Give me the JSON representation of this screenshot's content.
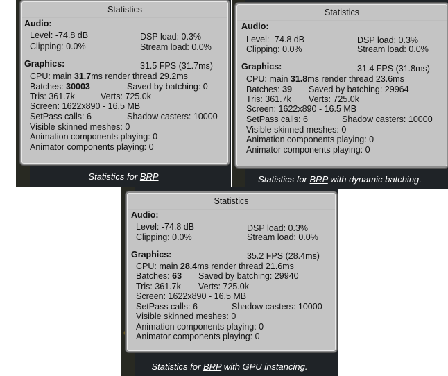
{
  "panels": [
    {
      "title": "Statistics",
      "audio_header": "Audio:",
      "audio_level": "Level: -74.8 dB",
      "audio_clipping": "Clipping: 0.0%",
      "audio_dsp": "DSP load: 0.3%",
      "audio_stream": "Stream load: 0.0%",
      "graphics_header": "Graphics:",
      "fps": "31.5 FPS (31.7ms)",
      "cpu_prefix": "CPU: main ",
      "cpu_main": "31.7",
      "cpu_suffix": "ms  render thread 29.2ms",
      "batches_prefix": "Batches: ",
      "batches": "30003",
      "saved_by_batching": "Saved by batching: 0",
      "tris": "Tris: 361.7k",
      "verts": "Verts: 725.0k",
      "screen": "Screen: 1622x890 - 16.5 MB",
      "setpass": "SetPass calls: 6",
      "shadow_casters": "Shadow casters: 10000",
      "visible_skinned": "Visible skinned meshes: 0",
      "animation_components": "Animation components playing: 0",
      "animator_components": "Animator components playing: 0",
      "caption_pre": "Statistics for ",
      "caption_link": "BRP",
      "caption_post": ""
    },
    {
      "title": "Statistics",
      "audio_header": "Audio:",
      "audio_level": "Level: -74.8 dB",
      "audio_clipping": "Clipping: 0.0%",
      "audio_dsp": "DSP load: 0.3%",
      "audio_stream": "Stream load: 0.0%",
      "graphics_header": "Graphics:",
      "fps": "31.4 FPS (31.8ms)",
      "cpu_prefix": "CPU: main ",
      "cpu_main": "31.8",
      "cpu_suffix": "ms  render thread 23.6ms",
      "batches_prefix": "Batches: ",
      "batches": "39",
      "saved_by_batching": "Saved by batching: 29964",
      "tris": "Tris: 361.7k",
      "verts": "Verts: 725.0k",
      "screen": "Screen: 1622x890 - 16.5 MB",
      "setpass": "SetPass calls: 6",
      "shadow_casters": "Shadow casters: 10000",
      "visible_skinned": "Visible skinned meshes: 0",
      "animation_components": "Animation components playing: 0",
      "animator_components": "Animator components playing: 0",
      "caption_pre": "Statistics for ",
      "caption_link": "BRP",
      "caption_post": " with dynamic batching."
    },
    {
      "title": "Statistics",
      "audio_header": "Audio:",
      "audio_level": "Level: -74.8 dB",
      "audio_clipping": "Clipping: 0.0%",
      "audio_dsp": "DSP load: 0.3%",
      "audio_stream": "Stream load: 0.0%",
      "graphics_header": "Graphics:",
      "fps": "35.2 FPS (28.4ms)",
      "cpu_prefix": "CPU: main ",
      "cpu_main": "28.4",
      "cpu_suffix": "ms  render thread 21.6ms",
      "batches_prefix": "Batches: ",
      "batches": "63",
      "saved_by_batching": "Saved by batching: 29940",
      "tris": "Tris: 361.7k",
      "verts": "Verts: 725.0k",
      "screen": "Screen: 1622x890 - 16.5 MB",
      "setpass": "SetPass calls: 6",
      "shadow_casters": "Shadow casters: 10000",
      "visible_skinned": "Visible skinned meshes: 0",
      "animation_components": "Animation components playing: 0",
      "animator_components": "Animator components playing: 0",
      "caption_pre": "Statistics for ",
      "caption_link": "BRP",
      "caption_post": " with GPU instancing."
    }
  ]
}
